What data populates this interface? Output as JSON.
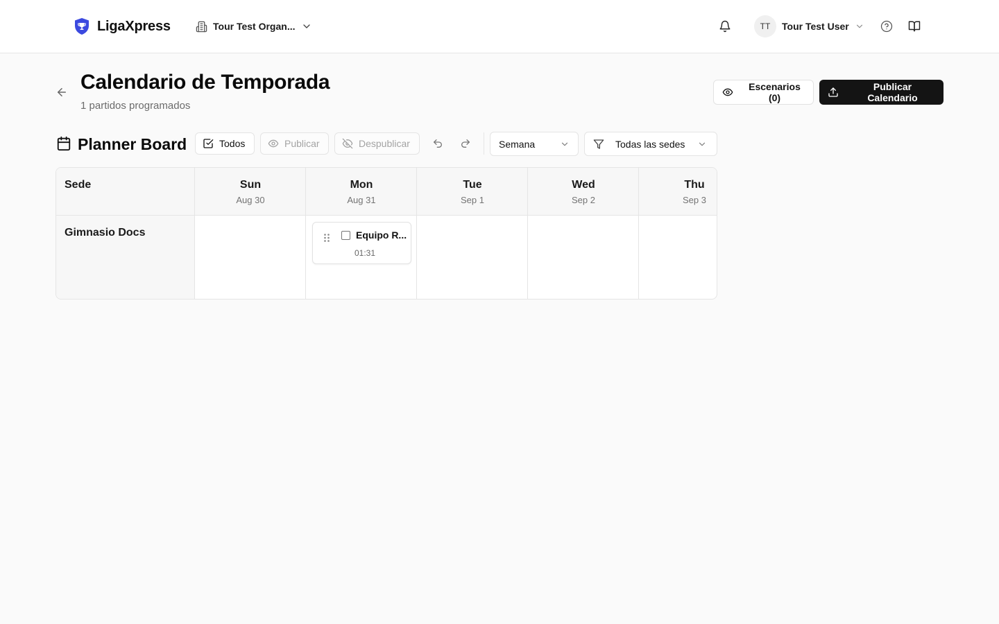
{
  "colors": {
    "brand": "#3b49df",
    "primary_button": "#141414",
    "border": "#e5e5e5",
    "muted_text": "#737373"
  },
  "header": {
    "brand_name": "LigaXpress",
    "organization": "Tour Test Organ...",
    "user": {
      "initials": "TT",
      "name": "Tour Test User"
    },
    "icons": [
      "shield-trophy-icon",
      "building-icon",
      "chevron-down-icon",
      "bell-icon",
      "help-circle-icon",
      "book-open-icon"
    ]
  },
  "page": {
    "title": "Calendario de Temporada",
    "subtitle": "1 partidos programados",
    "scenarios_label": "Escenarios (0)",
    "publish_calendar_label": "Publicar Calendario"
  },
  "planner": {
    "title": "Planner Board",
    "select_all_label": "Todos",
    "publish_label": "Publicar",
    "unpublish_label": "Despublicar",
    "view_mode": "Semana",
    "venue_filter": "Todas las sedes",
    "venue_column_header": "Sede",
    "days": [
      {
        "name": "Sun",
        "date": "Aug 30"
      },
      {
        "name": "Mon",
        "date": "Aug 31"
      },
      {
        "name": "Tue",
        "date": "Sep 1"
      },
      {
        "name": "Wed",
        "date": "Sep 2"
      },
      {
        "name": "Thu",
        "date": "Sep 3"
      }
    ],
    "venues": [
      {
        "name": "Gimnasio Docs",
        "matches": [
          {
            "day": "Mon",
            "title": "Equipo R...",
            "time": "01:31",
            "selected": false
          }
        ]
      }
    ]
  }
}
